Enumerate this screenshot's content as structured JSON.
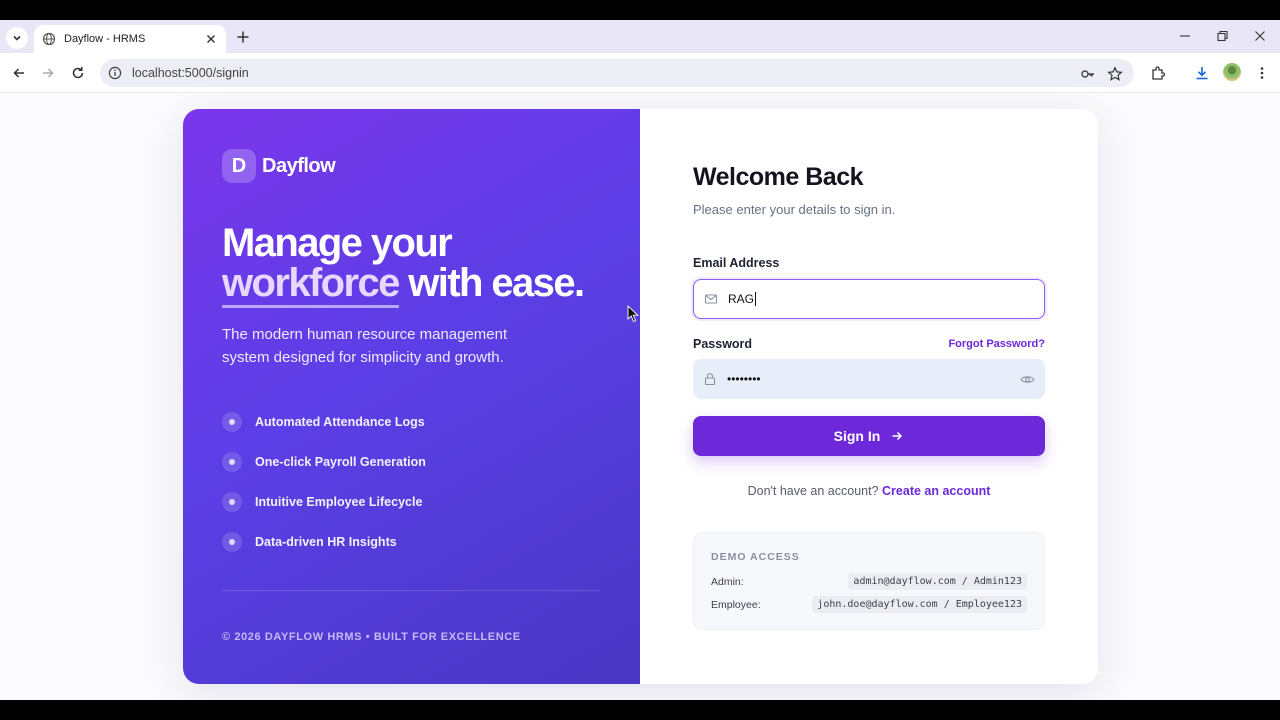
{
  "browser": {
    "tab_title": "Dayflow - HRMS",
    "url": "localhost:5000/signin"
  },
  "brand": {
    "logo_letter": "D",
    "name": "Dayflow"
  },
  "hero": {
    "headline_line1": "Manage your",
    "headline_accent": "workforce",
    "headline_rest": " with ease.",
    "subtext": "The modern human resource management system designed for simplicity and growth.",
    "features": [
      "Automated Attendance Logs",
      "One-click Payroll Generation",
      "Intuitive Employee Lifecycle",
      "Data-driven HR Insights"
    ],
    "copyright": "© 2026 DAYFLOW HRMS • BUILT FOR EXCELLENCE"
  },
  "form": {
    "title": "Welcome Back",
    "subtitle": "Please enter your details to sign in.",
    "email_label": "Email Address",
    "email_value": "RAG",
    "password_label": "Password",
    "forgot_label": "Forgot Password?",
    "password_value": "••••••••",
    "signin_label": "Sign In",
    "no_account_text": "Don't have an account?",
    "create_account_label": "Create an account"
  },
  "demo": {
    "title": "DEMO ACCESS",
    "admin_label": "Admin:",
    "admin_creds": "admin@dayflow.com / Admin123",
    "employee_label": "Employee:",
    "employee_creds": "john.doe@dayflow.com / Employee123"
  },
  "colors": {
    "accent": "#6d28d9",
    "panel_gradient_start": "#7a36ea",
    "panel_gradient_end": "#4a37c4"
  }
}
